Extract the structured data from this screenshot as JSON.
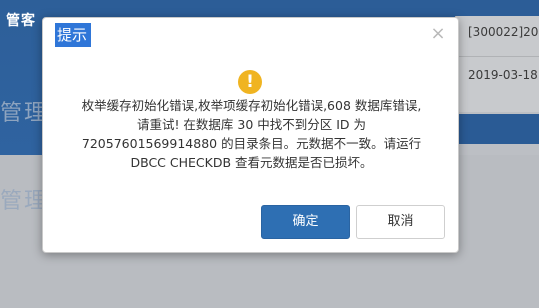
{
  "background": {
    "logo_text": "管客",
    "side_text": "管理",
    "table": {
      "row1": "[300022]20",
      "row2": "2019-03-18"
    }
  },
  "dialog": {
    "title": "提示",
    "close_symbol": "×",
    "warning_symbol": "!",
    "message_lines": [
      "枚举缓存初始化错误,枚举项缓存初始化错误,608 数据库错误,",
      "请重试! 在数据库 30 中找不到分区 ID 为",
      "72057601569914880 的目录条目。元数据不一致。请运行",
      "DBCC CHECKDB 查看元数据是否已损坏。"
    ],
    "ok_label": "确定",
    "cancel_label": "取消"
  },
  "colors": {
    "title_highlight": "#2f76d8",
    "ok_button": "#2e6fb3",
    "warning_icon": "#f0b421",
    "header_bg": "#2c5d97"
  }
}
